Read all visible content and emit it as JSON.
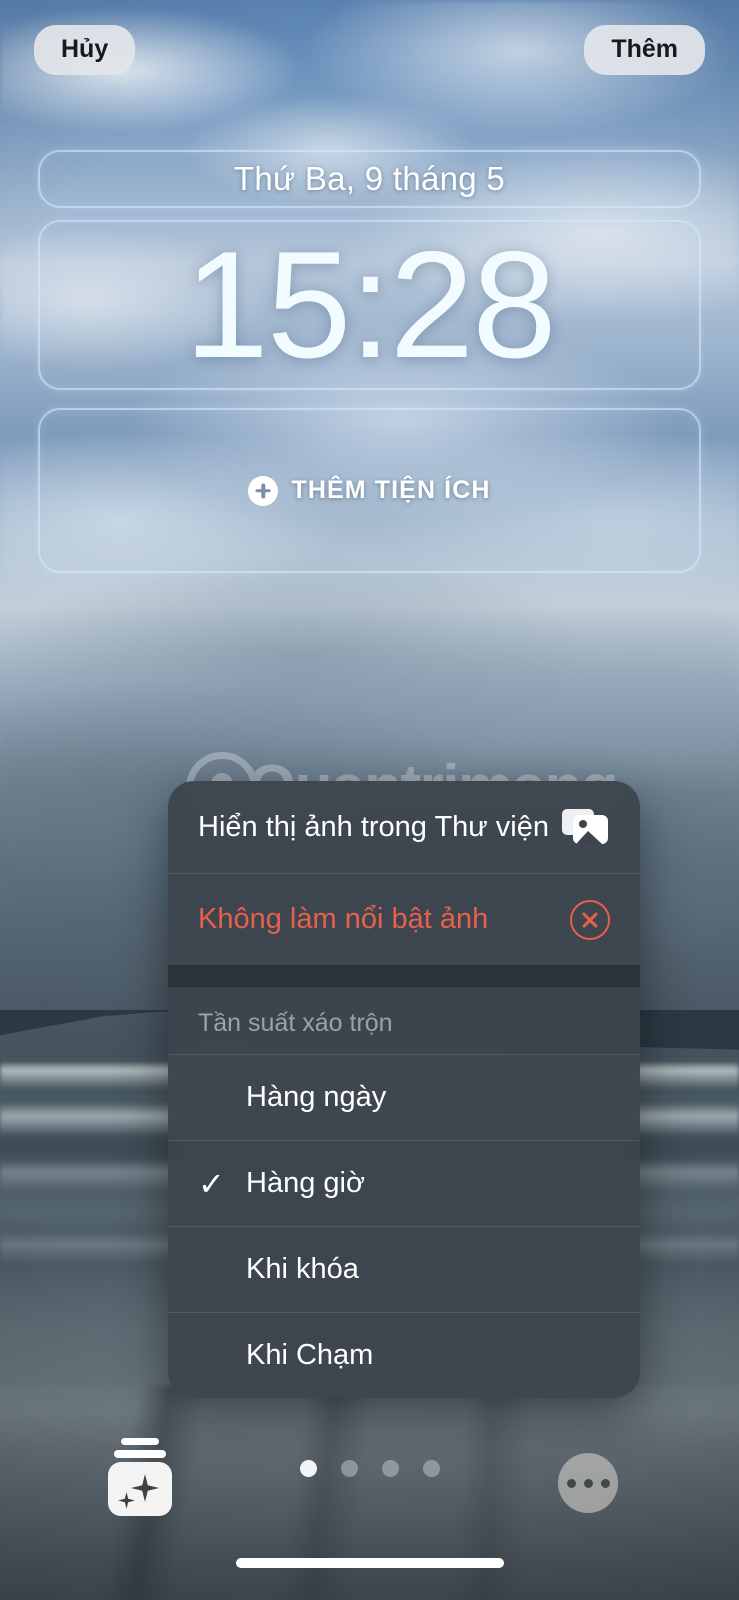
{
  "topbar": {
    "cancel_label": "Hủy",
    "add_label": "Thêm"
  },
  "lockscreen": {
    "date": "Thứ Ba, 9 tháng 5",
    "time": "15:28",
    "add_widgets_label": "THÊM TIỆN ÍCH"
  },
  "watermark": {
    "text": "Quantrimang"
  },
  "context_menu": {
    "show_in_library": {
      "label": "Hiển thị ảnh trong Thư viện",
      "icon": "photo-library-icon"
    },
    "unfeature_photo": {
      "label": "Không làm nổi bật ảnh",
      "icon": "x-circle-icon",
      "color": "#E8604C"
    },
    "section_header": "Tần suất xáo trộn",
    "frequency_options": [
      {
        "label": "Hàng ngày",
        "selected": false
      },
      {
        "label": "Hàng giờ",
        "selected": true
      },
      {
        "label": "Khi khóa",
        "selected": false
      },
      {
        "label": "Khi Chạm",
        "selected": false
      }
    ],
    "check_glyph": "✓"
  },
  "bottombar": {
    "shuffle_icon": "photo-shuffle-icon",
    "more_icon": "more-options-icon",
    "page_dots": {
      "count": 4,
      "active_index": 0
    }
  }
}
